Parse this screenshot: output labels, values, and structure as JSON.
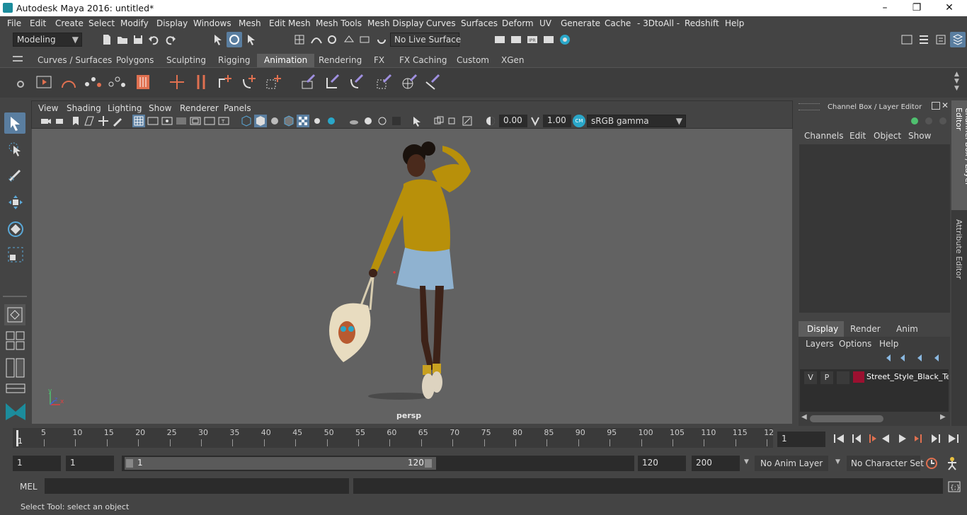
{
  "app": {
    "title": "Autodesk Maya 2016: untitled*",
    "window_controls": [
      "–",
      "❐",
      "✕"
    ]
  },
  "menubar": [
    "File",
    "Edit",
    "Create",
    "Select",
    "Modify",
    "Display",
    "Windows",
    "Mesh",
    "Edit Mesh",
    "Mesh Tools",
    "Mesh Display",
    "Curves",
    "Surfaces",
    "Deform",
    "UV",
    "Generate",
    "Cache",
    "- 3DtoAll -",
    "Redshift",
    "Help"
  ],
  "statusline": {
    "mode": "Modeling",
    "live_surface": "No Live Surface"
  },
  "shelf_tabs": [
    "Curves / Surfaces",
    "Polygons",
    "Sculpting",
    "Rigging",
    "Animation",
    "Rendering",
    "FX",
    "FX Caching",
    "Custom",
    "XGen"
  ],
  "active_shelf_tab": "Animation",
  "viewport": {
    "menus": [
      "View",
      "Shading",
      "Lighting",
      "Show",
      "Renderer",
      "Panels"
    ],
    "exposure": "0.00",
    "gamma": "1.00",
    "color_space": "sRGB gamma",
    "camera_label": "persp",
    "axis_labels": {
      "x": "x",
      "y": "y",
      "z": "z"
    }
  },
  "channel_box": {
    "title": "Channel Box / Layer Editor",
    "menus": [
      "Channels",
      "Edit",
      "Object",
      "Show"
    ],
    "layer_tabs": [
      "Display",
      "Render",
      "Anim"
    ],
    "active_layer_tab": "Display",
    "layer_menus": [
      "Layers",
      "Options",
      "Help"
    ],
    "layer": {
      "v": "V",
      "p": "P",
      "name": "Street_Style_Black_Teen",
      "color": "#9b1030"
    }
  },
  "side_tabs": [
    "Channel Box / Layer Editor",
    "Attribute Editor"
  ],
  "timeline": {
    "ticks": [
      "5",
      "10",
      "15",
      "20",
      "25",
      "30",
      "35",
      "40",
      "45",
      "50",
      "55",
      "60",
      "65",
      "70",
      "75",
      "80",
      "85",
      "90",
      "95",
      "100",
      "105",
      "110",
      "115",
      "12"
    ],
    "start_marker": "1",
    "current_frame": "1"
  },
  "range": {
    "start": "1",
    "playback_start": "1",
    "slider_start": "1",
    "slider_end": "120",
    "playback_end": "120",
    "end": "200",
    "anim_layer": "No Anim Layer",
    "character_set": "No Character Set"
  },
  "mel": {
    "label": "MEL"
  },
  "help_line": "Select Tool: select an object",
  "colors": {
    "accent_tool": "#5a7ea0",
    "teal": "#1c8c9c"
  }
}
